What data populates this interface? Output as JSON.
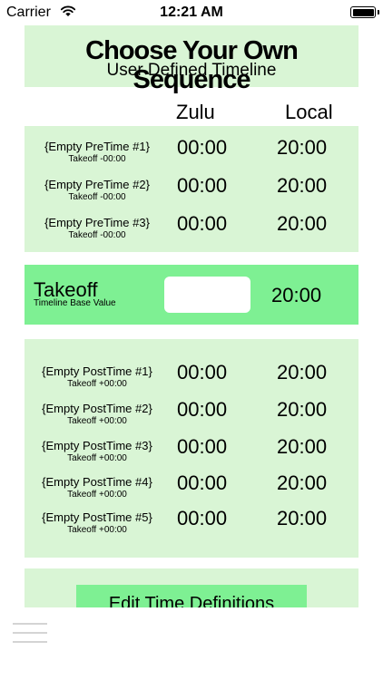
{
  "status_bar": {
    "carrier": "Carrier",
    "time": "12:21 AM",
    "wifi_icon": "wifi-icon",
    "battery_icon": "battery-icon"
  },
  "header": {
    "title": "Choose Your Own Sequence",
    "subtitle": "User Defined Timeline"
  },
  "columns": {
    "zulu": "Zulu",
    "local": "Local"
  },
  "pre_times": [
    {
      "name": "{Empty PreTime #1}",
      "offset": "Takeoff  -00:00",
      "zulu": "00:00",
      "local": "20:00"
    },
    {
      "name": "{Empty PreTime #2}",
      "offset": "Takeoff  -00:00",
      "zulu": "00:00",
      "local": "20:00"
    },
    {
      "name": "{Empty PreTime #3}",
      "offset": "Takeoff  -00:00",
      "zulu": "00:00",
      "local": "20:00"
    }
  ],
  "takeoff": {
    "title": "Takeoff",
    "subtitle": "Timeline Base Value",
    "zulu_input_value": "",
    "local": "20:00"
  },
  "post_times": [
    {
      "name": "{Empty PostTime #1}",
      "offset": "Takeoff  +00:00",
      "zulu": "00:00",
      "local": "20:00"
    },
    {
      "name": "{Empty PostTime #2}",
      "offset": "Takeoff  +00:00",
      "zulu": "00:00",
      "local": "20:00"
    },
    {
      "name": "{Empty PostTime #3}",
      "offset": "Takeoff  +00:00",
      "zulu": "00:00",
      "local": "20:00"
    },
    {
      "name": "{Empty PostTime #4}",
      "offset": "Takeoff  +00:00",
      "zulu": "00:00",
      "local": "20:00"
    },
    {
      "name": "{Empty PostTime #5}",
      "offset": "Takeoff  +00:00",
      "zulu": "00:00",
      "local": "20:00"
    }
  ],
  "footer": {
    "edit_button_label": "Edit Time Definitions",
    "menu_icon": "hamburger-menu-icon"
  },
  "colors": {
    "panel_light_green": "#d9f5d5",
    "accent_green": "#7ef093"
  }
}
